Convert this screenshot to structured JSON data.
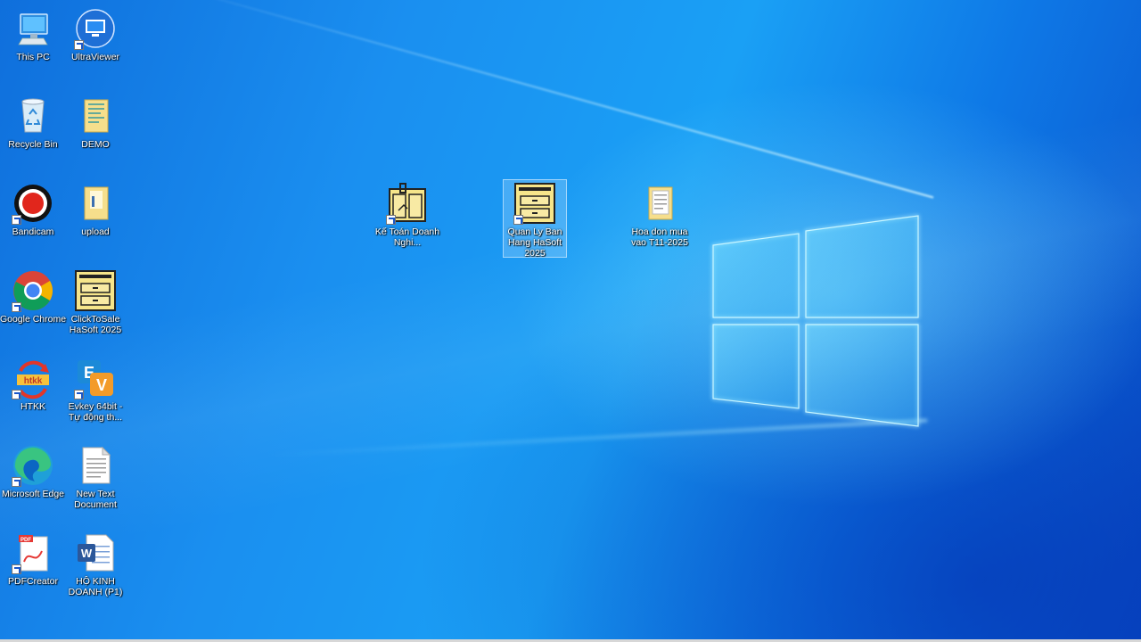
{
  "desktop": {
    "icons": [
      {
        "label": "This PC"
      },
      {
        "label": "UltraViewer"
      },
      {
        "label": "Recycle Bin"
      },
      {
        "label": "DEMO"
      },
      {
        "label": "Bandicam"
      },
      {
        "label": "upload"
      },
      {
        "label": "Google Chrome"
      },
      {
        "label": "ClickToSale HaSoft 2025"
      },
      {
        "label": "HTKK"
      },
      {
        "label": "Evkey 64bit - Tự động th..."
      },
      {
        "label": "Microsoft Edge"
      },
      {
        "label": "New Text Document"
      },
      {
        "label": "PDFCreator"
      },
      {
        "label": "HỘ KINH DOANH (P1)"
      },
      {
        "label": "Kế Toán Doanh Nghi..."
      },
      {
        "label": "Quan Ly Ban Hang HaSoft 2025"
      },
      {
        "label": "Hoa don mua vao T11-2025"
      }
    ]
  },
  "colors": {
    "wallpaper_blue": "#1a8ff0",
    "selection": "#bee1ff"
  }
}
